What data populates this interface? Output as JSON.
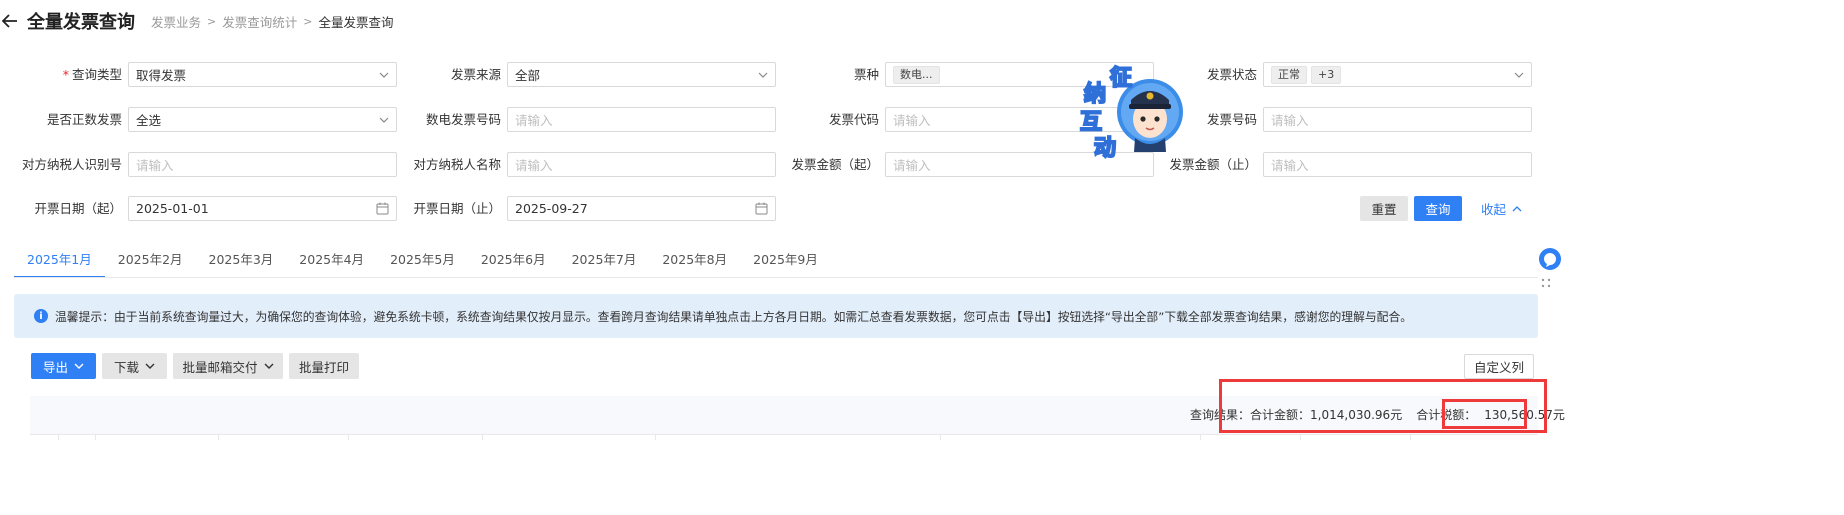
{
  "header": {
    "title": "全量发票查询",
    "breadcrumbs": [
      "发票业务",
      "发票查询统计",
      "全量发票查询"
    ]
  },
  "form": {
    "query_type": {
      "label": "查询类型",
      "value": "取得发票"
    },
    "invoice_source": {
      "label": "发票来源",
      "value": "全部"
    },
    "ticket_type": {
      "label": "票种",
      "tag": "数电..."
    },
    "invoice_status": {
      "label": "发票状态",
      "tag": "正常",
      "more": "+3"
    },
    "is_positive": {
      "label": "是否正数发票",
      "value": "全选"
    },
    "digital_no": {
      "label": "数电发票号码",
      "placeholder": "请输入"
    },
    "invoice_code": {
      "label": "发票代码",
      "placeholder": "请输入"
    },
    "invoice_no": {
      "label": "发票号码",
      "placeholder": "请输入"
    },
    "counterparty_id": {
      "label": "对方纳税人识别号",
      "placeholder": "请输入"
    },
    "counterparty_name": {
      "label": "对方纳税人名称",
      "placeholder": "请输入"
    },
    "amount_from": {
      "label": "发票金额（起）",
      "placeholder": "请输入"
    },
    "amount_to": {
      "label": "发票金额（止）",
      "placeholder": "请输入"
    },
    "date_from": {
      "label": "开票日期（起）",
      "value": "2025-01-01"
    },
    "date_to": {
      "label": "开票日期（止）",
      "value": "2025-09-27"
    },
    "reset_label": "重置",
    "query_label": "查询",
    "collapse_label": "收起"
  },
  "mascot": {
    "chars": [
      "征",
      "纳",
      "互",
      "动"
    ]
  },
  "tabs": [
    "2025年1月",
    "2025年2月",
    "2025年3月",
    "2025年4月",
    "2025年5月",
    "2025年6月",
    "2025年7月",
    "2025年8月",
    "2025年9月"
  ],
  "notice": {
    "text": "温馨提示：由于当前系统查询量过大，为确保您的查询体验，避免系统卡顿，系统查询结果仅按月显示。查看跨月查询结果请单独点击上方各月日期。如需汇总查看发票数据，您可点击【导出】按钮选择“导出全部”下载全部发票查询结果，感谢您的理解与配合。"
  },
  "toolbar": {
    "export": "导出",
    "download": "下载",
    "batch_mail": "批量邮箱交付",
    "batch_print": "批量打印",
    "custom_columns": "自定义列"
  },
  "summary": {
    "result_label": "查询结果：",
    "total_amount_label": "合计金额：",
    "total_amount": "1,014,030.96元",
    "total_tax_label": "合计税额：",
    "total_tax": "130,560.57元"
  },
  "colors": {
    "accent": "#2f7ff5",
    "highlight": "#ee3a3a"
  }
}
